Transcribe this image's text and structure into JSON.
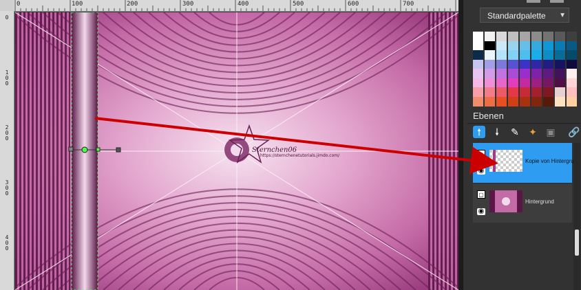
{
  "ruler": {
    "top_ticks": [
      "0",
      "100",
      "200",
      "300",
      "400",
      "500",
      "600",
      "700"
    ],
    "left_ticks": [
      "0",
      "100",
      "200",
      "300",
      "400"
    ]
  },
  "watermark": {
    "name": "Sternchen06",
    "url": "https://sternchenetutorials.jimdo.com/"
  },
  "palette": {
    "selected": "Standardpalette",
    "colors": [
      [
        "#ffffff",
        "#f2f2f2",
        "#d9d9d9",
        "#bfbfbf",
        "#a6a6a6",
        "#8c8c8c",
        "#737373",
        "#595959",
        "#3f3f3f"
      ],
      [
        "#ffffff",
        "#000000",
        "#cce9f7",
        "#99d4ef",
        "#66bfe8",
        "#33aae0",
        "#1196d8",
        "#0a7cb5",
        "#065a85"
      ],
      [
        "#0c2b4a",
        "#eaf6fc",
        "#b3e3f8",
        "#80d1f3",
        "#4dbfee",
        "#1aaee9",
        "#0c8ec4",
        "#086c96",
        "#054a68"
      ],
      [
        "#c7c6f0",
        "#a29fe6",
        "#7d78dc",
        "#5851d2",
        "#3c32c8",
        "#2f27a6",
        "#231d83",
        "#171360",
        "#0e0b3d"
      ],
      [
        "#e7c4f2",
        "#d39ce9",
        "#bf74df",
        "#ab4cd6",
        "#9a2ecd",
        "#7d23a8",
        "#601b83",
        "#43125d",
        "#fff0f0"
      ],
      [
        "#f6b8e6",
        "#ef8fd8",
        "#e866ca",
        "#e23dbc",
        "#c12aa0",
        "#9c2082",
        "#761763",
        "#500e44",
        "#ffd6d6"
      ],
      [
        "#f7a0a8",
        "#f27d88",
        "#ec5a68",
        "#e63748",
        "#c72a39",
        "#a3212e",
        "#7e1823",
        "#e6d0d0",
        "#ffc0c0"
      ],
      [
        "#f28c6b",
        "#ee6d45",
        "#ea4f22",
        "#d13f14",
        "#a83210",
        "#80260c",
        "#581a08",
        "#ffe0c0",
        "#ffd0a0"
      ]
    ]
  },
  "layers": {
    "title": "Ebenen",
    "items": [
      {
        "name": "Kopie von Hintergrund",
        "selected": true
      },
      {
        "name": "Hintergrund",
        "selected": false
      }
    ]
  },
  "colors": {
    "selected_layer": "#2e9cf0",
    "arrow": "#cc0000",
    "fractal_light": "#f3d9ec",
    "fractal_mid": "#c66aa8",
    "fractal_dark": "#5a1746"
  }
}
